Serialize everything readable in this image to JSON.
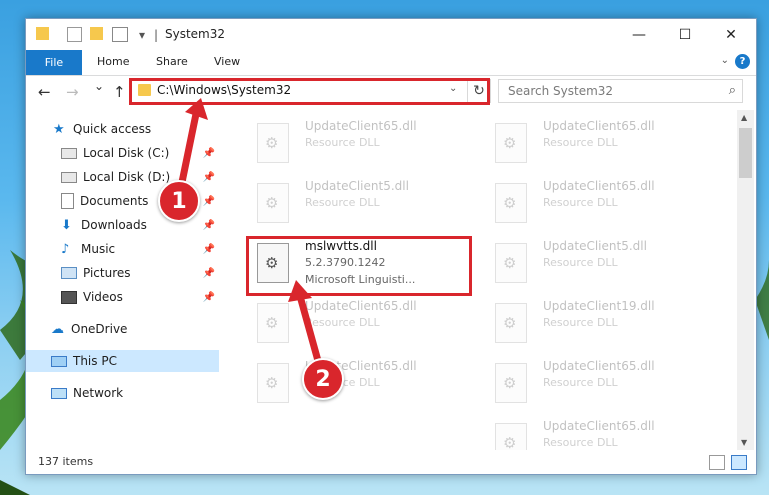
{
  "window": {
    "title": "System32",
    "minimize": "—",
    "maximize": "☐",
    "close": "✕"
  },
  "ribbon": {
    "tabs": [
      "File",
      "Home",
      "Share",
      "View"
    ],
    "help": "?"
  },
  "nav": {
    "back": "←",
    "forward": "→",
    "recent": "⌄",
    "up": "↑",
    "address": "C:\\Windows\\System32",
    "refresh": "↻",
    "search_placeholder": "Search System32"
  },
  "sidebar": {
    "items": [
      {
        "label": "Quick access",
        "icon": "star-icon",
        "pinned": false
      },
      {
        "label": "Local Disk (C:)",
        "icon": "drive-icon",
        "pinned": true
      },
      {
        "label": "Local Disk (D:)",
        "icon": "drive-icon",
        "pinned": true
      },
      {
        "label": "Documents",
        "icon": "documents-icon",
        "pinned": true
      },
      {
        "label": "Downloads",
        "icon": "downloads-icon",
        "pinned": true
      },
      {
        "label": "Music",
        "icon": "music-icon",
        "pinned": true
      },
      {
        "label": "Pictures",
        "icon": "pictures-icon",
        "pinned": true
      },
      {
        "label": "Videos",
        "icon": "videos-icon",
        "pinned": true
      },
      {
        "label": "OneDrive",
        "icon": "onedrive-icon",
        "pinned": false
      },
      {
        "label": "This PC",
        "icon": "pc-icon",
        "pinned": false,
        "selected": true
      },
      {
        "label": "Network",
        "icon": "network-icon",
        "pinned": false
      }
    ]
  },
  "files": {
    "left": [
      {
        "name": "UpdateClient65.dll",
        "desc": "Resource DLL"
      },
      {
        "name": "UpdateClient5.dll",
        "desc": "Resource DLL"
      },
      {
        "name": "mslwvtts.dll",
        "desc": "5.2.3790.1242",
        "desc2": "Microsoft Linguisti..."
      },
      {
        "name": "UpdateClient65.dll",
        "desc": "Resource DLL"
      },
      {
        "name": "UpdateClient65.dll",
        "desc": "Resource DLL"
      }
    ],
    "right": [
      {
        "name": "UpdateClient65.dll",
        "desc": "Resource DLL"
      },
      {
        "name": "UpdateClient65.dll",
        "desc": "Resource DLL"
      },
      {
        "name": "UpdateClient5.dll",
        "desc": "Resource DLL"
      },
      {
        "name": "UpdateClient19.dll",
        "desc": "Resource DLL"
      },
      {
        "name": "UpdateClient65.dll",
        "desc": "Resource DLL"
      },
      {
        "name": "UpdateClient65.dll",
        "desc": "Resource DLL"
      }
    ]
  },
  "status": {
    "count": "137 items"
  },
  "annotations": {
    "badge1": "1",
    "badge2": "2",
    "color": "#d9262c"
  }
}
